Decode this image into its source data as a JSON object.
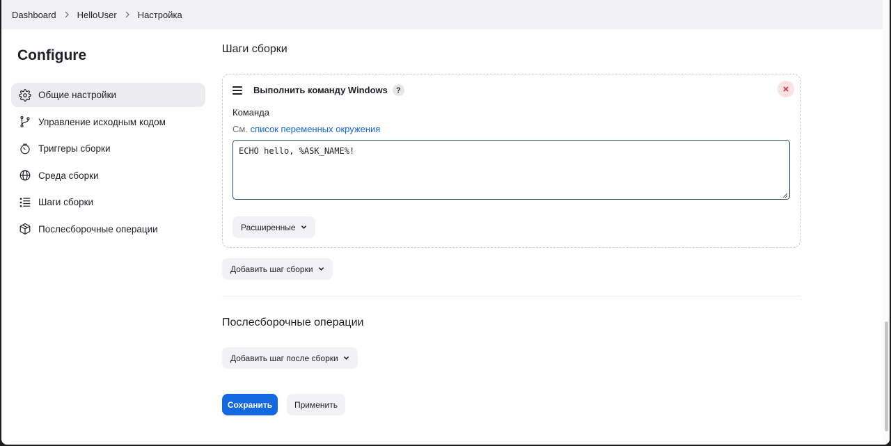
{
  "breadcrumb": [
    "Dashboard",
    "HelloUser",
    "Настройка"
  ],
  "sidebar": {
    "title": "Configure",
    "items": [
      {
        "label": "Общие настройки",
        "icon": "gear-icon",
        "active": true
      },
      {
        "label": "Управление исходным кодом",
        "icon": "branch-icon",
        "active": false
      },
      {
        "label": "Триггеры сборки",
        "icon": "clock-icon",
        "active": false
      },
      {
        "label": "Среда сборки",
        "icon": "globe-icon",
        "active": false
      },
      {
        "label": "Шаги сборки",
        "icon": "list-icon",
        "active": false
      },
      {
        "label": "Послесборочные операции",
        "icon": "package-icon",
        "active": false
      }
    ]
  },
  "build_steps": {
    "section_title": "Шаги сборки",
    "step": {
      "title": "Выполнить команду Windows",
      "help": "?",
      "field_label": "Команда",
      "hint_prefix": "См.",
      "hint_link": "список переменных окружения",
      "command": "ECHO hello, %ASK_NAME%!",
      "advanced_label": "Расширенные"
    },
    "add_button": "Добавить шаг сборки"
  },
  "post_build": {
    "section_title": "Послесборочные операции",
    "add_button": "Добавить шаг после сборки"
  },
  "actions": {
    "save": "Сохранить",
    "apply": "Применить"
  },
  "colors": {
    "primary": "#1468e0",
    "link": "#1466d1",
    "danger": "#d33a3a"
  }
}
